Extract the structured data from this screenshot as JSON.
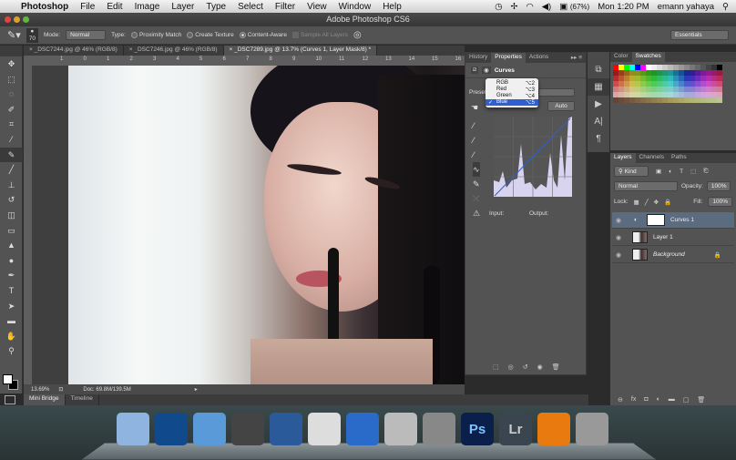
{
  "menubar": {
    "apple": "",
    "app": "Photoshop",
    "items": [
      "File",
      "Edit",
      "Image",
      "Layer",
      "Type",
      "Select",
      "Filter",
      "View",
      "Window",
      "Help"
    ],
    "battery": "(67%)",
    "clock": "Mon 1:20 PM",
    "user": "emann yahaya"
  },
  "window": {
    "title": "Adobe Photoshop CS6"
  },
  "options": {
    "brush_size": "70",
    "mode_label": "Mode:",
    "mode_value": "Normal",
    "type_label": "Type:",
    "proximity": "Proximity Match",
    "texture": "Create Texture",
    "content_aware": "Content-Aware",
    "sample_all": "Sample All Layers",
    "workspace": "Essentials"
  },
  "tabs": [
    "_DSC7244.jpg @ 46% (RGB/8)",
    "_DSC7246.jpg @ 46% (RGB/8)",
    "_DSC7289.jpg @ 13.7% (Curves 1, Layer Mask/8) *"
  ],
  "ruler": [
    "1",
    "0",
    "1",
    "2",
    "3",
    "4",
    "5",
    "6",
    "7",
    "8",
    "9",
    "10",
    "11",
    "12",
    "13",
    "14",
    "15",
    "16"
  ],
  "status": {
    "zoom": "13.69%",
    "doc": "Doc: 69.8M/139.5M"
  },
  "bottom_tabs": [
    "Mini Bridge",
    "Timeline"
  ],
  "properties": {
    "tabs": [
      "History",
      "Properties",
      "Actions"
    ],
    "title": "Curves",
    "preset_label": "Preset",
    "auto": "Auto",
    "input": "Input:",
    "output": "Output:",
    "channel_menu": [
      {
        "label": "RGB",
        "key": "⌥2"
      },
      {
        "label": "Red",
        "key": "⌥3"
      },
      {
        "label": "Green",
        "key": "⌥4"
      },
      {
        "label": "Blue",
        "key": "⌥5",
        "checked": true
      }
    ]
  },
  "color_panel": {
    "tabs": [
      "Color",
      "Swatches"
    ]
  },
  "layers_panel": {
    "tabs": [
      "Layers",
      "Channels",
      "Paths"
    ],
    "kind": "Kind",
    "blend": "Normal",
    "opacity_label": "Opacity:",
    "opacity": "100%",
    "lock_label": "Lock:",
    "fill_label": "Fill:",
    "fill": "100%",
    "layers": [
      {
        "name": "Curves 1",
        "selected": true
      },
      {
        "name": "Layer 1"
      },
      {
        "name": "Background",
        "locked": true
      }
    ]
  },
  "dock": [
    {
      "name": "Finder",
      "color": "#8fb4e0"
    },
    {
      "name": "Crown",
      "color": "#114a8c"
    },
    {
      "name": "Safari",
      "color": "#5a9ad8"
    },
    {
      "name": "iMovie",
      "color": "#444"
    },
    {
      "name": "Final Cut",
      "color": "#2a5a9a"
    },
    {
      "name": "Chrome",
      "color": "#ddd"
    },
    {
      "name": "iTunes",
      "color": "#2a6ac8"
    },
    {
      "name": "YouTube",
      "color": "#bbb"
    },
    {
      "name": "System Preferences",
      "color": "#888"
    },
    {
      "name": "Ps",
      "color": "#0a1f4a",
      "label": "Ps"
    },
    {
      "name": "Lr",
      "color": "#3a4550",
      "label": "Lr"
    },
    {
      "name": "VLC",
      "color": "#e87a10"
    },
    {
      "name": "Trash",
      "color": "#999"
    }
  ],
  "colors": {
    "accent": "#2f5fd0",
    "panel": "#535353",
    "selected_layer": "#5b6b80"
  }
}
